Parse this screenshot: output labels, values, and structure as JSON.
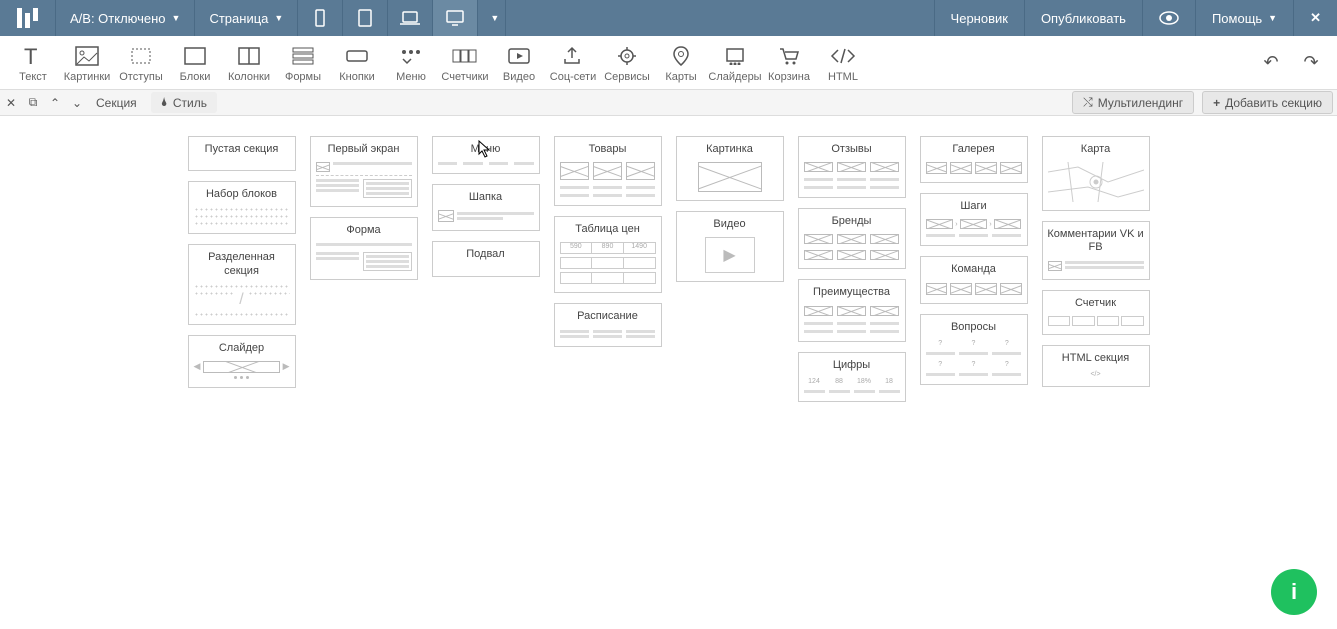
{
  "topbar": {
    "ab_label": "A/B: Отключено",
    "page_label": "Страница",
    "status": "Черновик",
    "publish": "Опубликовать",
    "help": "Помощь"
  },
  "tools": {
    "text": "Текст",
    "images": "Картинки",
    "spacing": "Отступы",
    "blocks": "Блоки",
    "columns": "Колонки",
    "forms": "Формы",
    "buttons": "Кнопки",
    "menu": "Меню",
    "counters": "Счетчики",
    "video": "Видео",
    "social": "Соц-сети",
    "services": "Сервисы",
    "maps": "Карты",
    "sliders": "Слайдеры",
    "cart": "Корзина",
    "html": "HTML"
  },
  "sectionbar": {
    "section": "Секция",
    "style": "Стиль",
    "multilanding": "Мультилендинг",
    "add_section": "Добавить секцию"
  },
  "templates": {
    "col1": [
      "Пустая секция",
      "Набор блоков",
      "Разделенная секция",
      "Слайдер"
    ],
    "col2": [
      "Первый экран",
      "Форма"
    ],
    "col3": [
      "Меню",
      "Шапка",
      "Подвал"
    ],
    "col4": [
      "Товары",
      "Таблица цен",
      "Расписание"
    ],
    "col5": [
      "Картинка",
      "Видео"
    ],
    "col6": [
      "Отзывы",
      "Бренды",
      "Преимущества",
      "Цифры"
    ],
    "col7": [
      "Галерея",
      "Шаги",
      "Команда",
      "Вопросы"
    ],
    "col8": [
      "Карта",
      "Комментарии VK и FB",
      "Счетчик",
      "HTML секция"
    ]
  },
  "pricing_cells": [
    "590",
    "890",
    "1490"
  ],
  "digits_cells": [
    "124",
    "88",
    "18%",
    "18"
  ]
}
